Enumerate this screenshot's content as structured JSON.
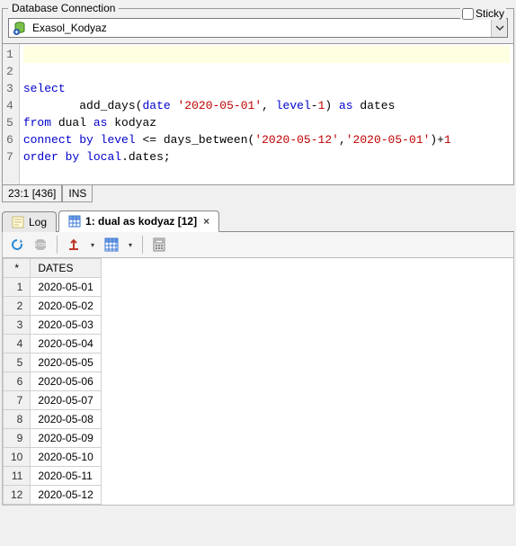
{
  "connection": {
    "legend": "Database Connection",
    "sticky_label": "Sticky",
    "name": "Exasol_Kodyaz"
  },
  "editor": {
    "lines": [
      "1",
      "2",
      "3",
      "4",
      "5",
      "6",
      "7"
    ],
    "code_tokens": [
      [],
      [
        {
          "t": "select",
          "c": "kw"
        }
      ],
      [
        {
          "t": "        ",
          "c": ""
        },
        {
          "t": "add_days",
          "c": "fn"
        },
        {
          "t": "(",
          "c": ""
        },
        {
          "t": "date",
          "c": "ty"
        },
        {
          "t": " ",
          "c": ""
        },
        {
          "t": "'2020-05-01'",
          "c": "str"
        },
        {
          "t": ", ",
          "c": ""
        },
        {
          "t": "level",
          "c": "kw"
        },
        {
          "t": "-",
          "c": ""
        },
        {
          "t": "1",
          "c": "num"
        },
        {
          "t": ") ",
          "c": ""
        },
        {
          "t": "as",
          "c": "kw"
        },
        {
          "t": " dates",
          "c": "id"
        }
      ],
      [
        {
          "t": "from",
          "c": "kw"
        },
        {
          "t": " dual ",
          "c": "id"
        },
        {
          "t": "as",
          "c": "kw"
        },
        {
          "t": " kodyaz",
          "c": "id"
        }
      ],
      [
        {
          "t": "connect by",
          "c": "kw"
        },
        {
          "t": " ",
          "c": ""
        },
        {
          "t": "level",
          "c": "kw"
        },
        {
          "t": " <= ",
          "c": ""
        },
        {
          "t": "days_between",
          "c": "fn"
        },
        {
          "t": "(",
          "c": ""
        },
        {
          "t": "'2020-05-12'",
          "c": "str"
        },
        {
          "t": ",",
          "c": ""
        },
        {
          "t": "'2020-05-01'",
          "c": "str"
        },
        {
          "t": ")+",
          "c": ""
        },
        {
          "t": "1",
          "c": "num"
        }
      ],
      [
        {
          "t": "order by",
          "c": "kw"
        },
        {
          "t": " ",
          "c": ""
        },
        {
          "t": "local",
          "c": "kw"
        },
        {
          "t": ".dates;",
          "c": "id"
        }
      ],
      []
    ]
  },
  "status": {
    "pos": "23:1 [436]",
    "mode": "INS"
  },
  "tabs": {
    "log_label": "Log",
    "result_label": "1: dual as kodyaz [12]"
  },
  "results": {
    "corner": "*",
    "columns": [
      "DATES"
    ],
    "rows": [
      {
        "n": "1",
        "v": [
          "2020-05-01"
        ]
      },
      {
        "n": "2",
        "v": [
          "2020-05-02"
        ]
      },
      {
        "n": "3",
        "v": [
          "2020-05-03"
        ]
      },
      {
        "n": "4",
        "v": [
          "2020-05-04"
        ]
      },
      {
        "n": "5",
        "v": [
          "2020-05-05"
        ]
      },
      {
        "n": "6",
        "v": [
          "2020-05-06"
        ]
      },
      {
        "n": "7",
        "v": [
          "2020-05-07"
        ]
      },
      {
        "n": "8",
        "v": [
          "2020-05-08"
        ]
      },
      {
        "n": "9",
        "v": [
          "2020-05-09"
        ]
      },
      {
        "n": "10",
        "v": [
          "2020-05-10"
        ]
      },
      {
        "n": "11",
        "v": [
          "2020-05-11"
        ]
      },
      {
        "n": "12",
        "v": [
          "2020-05-12"
        ]
      }
    ]
  }
}
